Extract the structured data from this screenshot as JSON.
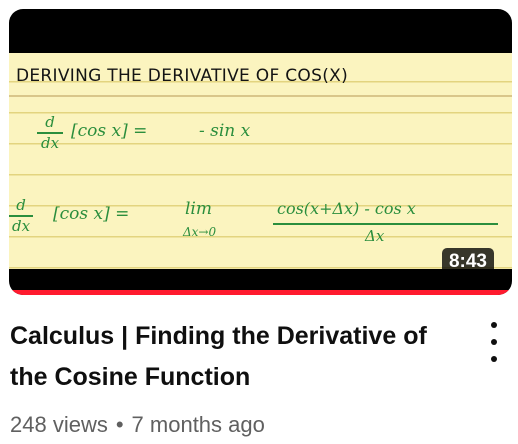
{
  "video": {
    "thumbnail": {
      "heading": "DERIVING THE DERIVATIVE OF COS(X)",
      "eq1": {
        "d": "d",
        "dx": "dx",
        "lhs": "[cos x] =",
        "rhs": "- sin x"
      },
      "eq2": {
        "d": "d",
        "dx": "dx",
        "lhs": "[cos x] =",
        "lim": "lim",
        "lim_sub": "Δx→0",
        "numerator": "cos(x+Δx) - cos x",
        "denominator": "Δx"
      },
      "duration": "8:43",
      "progress_fraction": 1.0,
      "colors": {
        "paper": "#fbf4bf",
        "ink": "#2b8e3d",
        "progress": "#ff1a2e"
      }
    },
    "title": "Calculus | Finding the Derivative of the Cosine Function",
    "views": "248 views",
    "separator": "•",
    "age": "7 months ago",
    "menu_icon": "more-vertical-icon"
  }
}
